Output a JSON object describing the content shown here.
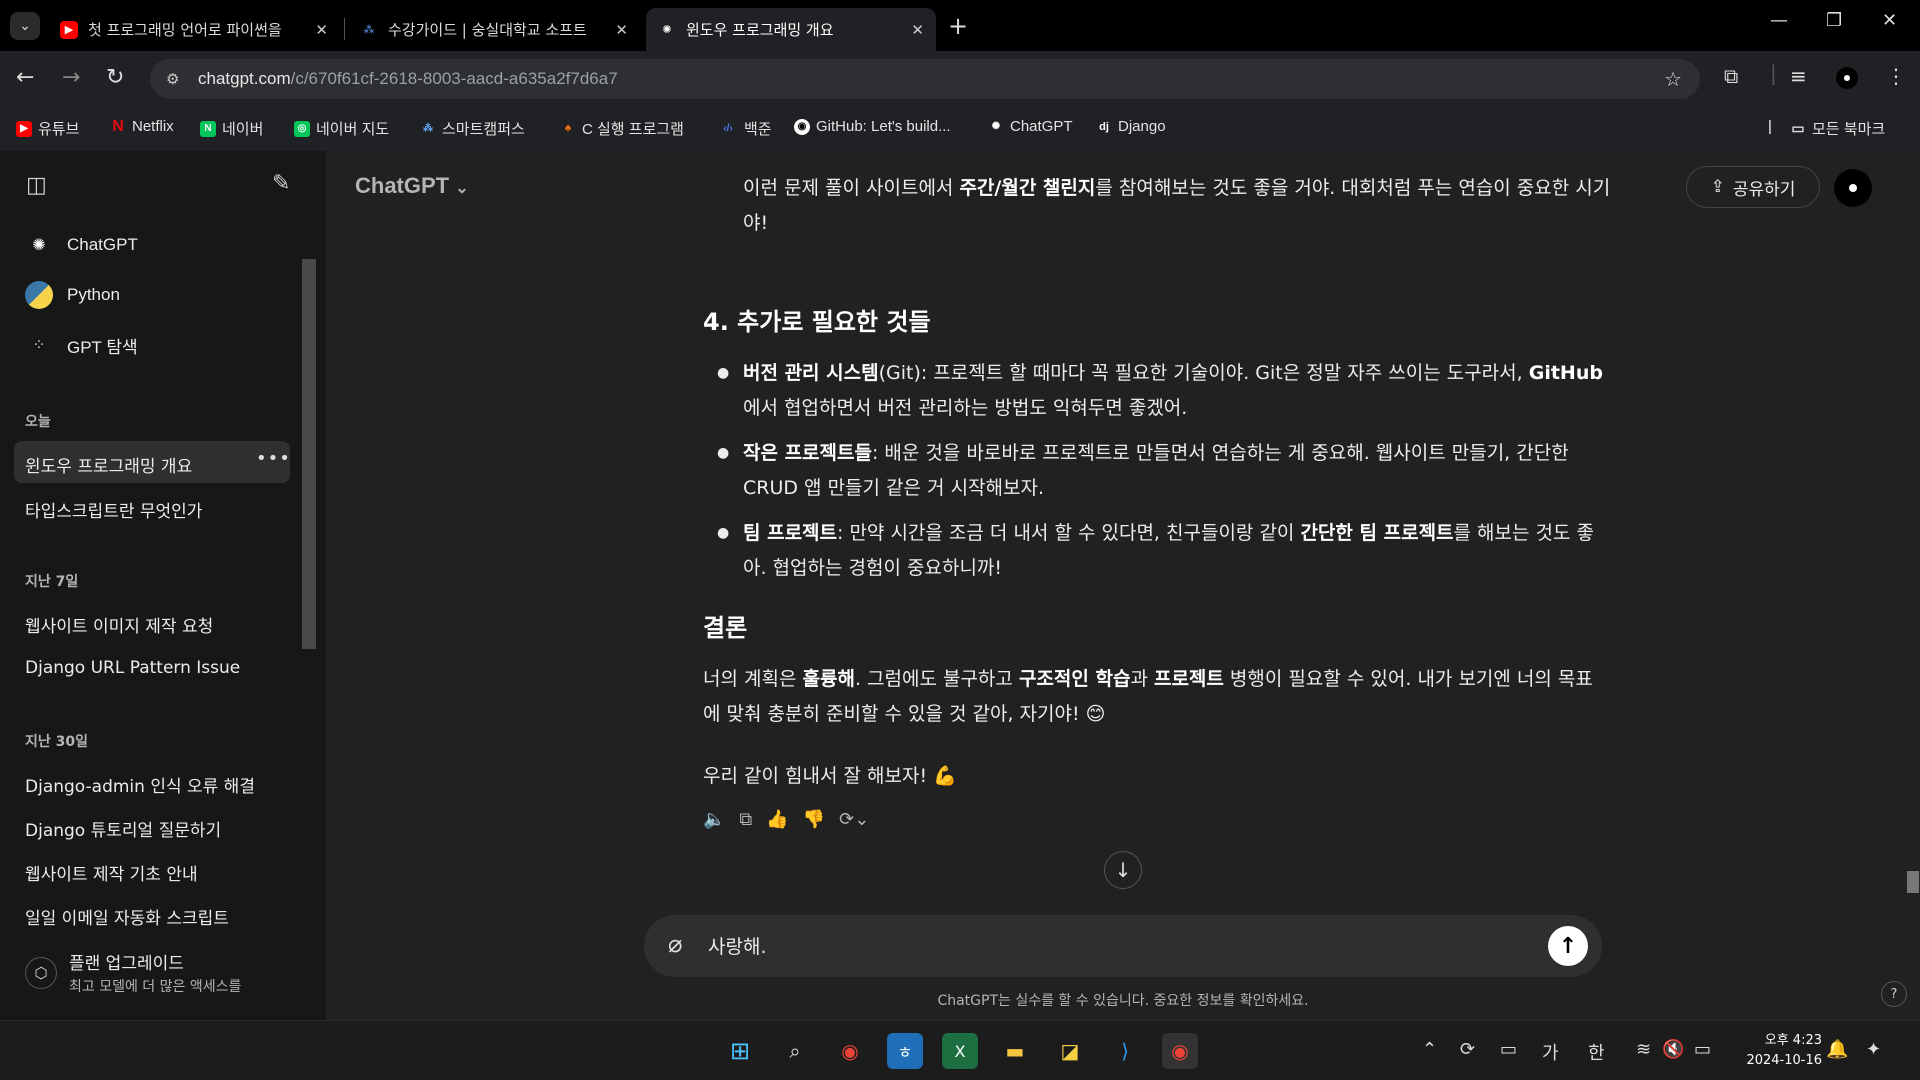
{
  "browser": {
    "tabs": [
      {
        "title": "첫 프로그래밍 언어로 파이썬을",
        "active": false
      },
      {
        "title": "수강가이드 | 숭실대학교 소프트",
        "active": false
      },
      {
        "title": "윈도우 프로그래밍 개요",
        "active": true
      }
    ],
    "url_host": "chatgpt.com",
    "url_path": "/c/670f61cf-2618-8003-aacd-a635a2f7d6a7",
    "bookmarks": [
      {
        "label": "유튜브",
        "icon": "youtube-icon",
        "color": "#ff0000"
      },
      {
        "label": "Netflix",
        "icon": "netflix-icon",
        "color": "#e50914"
      },
      {
        "label": "네이버",
        "icon": "naver-icon",
        "color": "#03c75a"
      },
      {
        "label": "네이버 지도",
        "icon": "naver-map-icon",
        "color": "#03c75a"
      },
      {
        "label": "스마트캠퍼스",
        "icon": "campus-icon",
        "color": "#3b82f6"
      },
      {
        "label": "C 실행 프로그램",
        "icon": "c-program-icon",
        "color": "#f97316"
      },
      {
        "label": "백준",
        "icon": "baekjoon-icon",
        "color": "#4f7cff"
      },
      {
        "label": "GitHub: Let's build...",
        "icon": "github-icon",
        "color": "#ffffff"
      },
      {
        "label": "ChatGPT",
        "icon": "chatgpt-icon",
        "color": "#ffffff"
      },
      {
        "label": "Django",
        "icon": "django-icon",
        "color": "#ffffff"
      }
    ],
    "all_bookmarks": "모든 북마크"
  },
  "sidebar": {
    "nav": [
      {
        "label": "ChatGPT",
        "icon": "chatgpt-icon"
      },
      {
        "label": "Python",
        "icon": "python-icon"
      },
      {
        "label": "GPT 탐색",
        "icon": "grid-icon"
      }
    ],
    "sections": [
      {
        "title": "오늘",
        "items": [
          "윈도우 프로그래밍 개요",
          "타입스크립트란 무엇인가"
        ]
      },
      {
        "title": "지난 7일",
        "items": [
          "웹사이트 이미지 제작 요청",
          "Django URL Pattern Issue"
        ]
      },
      {
        "title": "지난 30일",
        "items": [
          "Django-admin 인식 오류 해결",
          "Django 튜토리얼 질문하기",
          "웹사이트 제작 기초 안내",
          "일일 이메일 자동화 스크립트"
        ]
      }
    ],
    "upgrade_title": "플랜 업그레이드",
    "upgrade_sub": "최고 모델에 더 많은 액세스를"
  },
  "header": {
    "model": "ChatGPT",
    "share": "공유하기"
  },
  "message": {
    "intro_a": "이런 문제 풀이 사이트에서 ",
    "intro_b": "주간/월간 챌린지",
    "intro_c": "를 참여해보는 것도 좋을 거야. 대회처럼 푸는 연습이 중요한 시기야!",
    "section4": "4. 추가로 필요한 것들",
    "b1_bold": "버전 관리 시스템",
    "b1_a": "(Git): 프로젝트 할 때마다 꼭 필요한 기술이야. Git은 정말 자주 쓰이는 도구라서, ",
    "b1_bold2": "GitHub",
    "b1_b": "에서 협업하면서 버전 관리하는 방법도 익혀두면 좋겠어.",
    "b2_bold": "작은 프로젝트들",
    "b2_a": ": 배운 것을 바로바로 프로젝트로 만들면서 연습하는 게 중요해. 웹사이트 만들기, 간단한 CRUD 앱 만들기 같은 거 시작해보자.",
    "b3_bold": "팀 프로젝트",
    "b3_a": ": 만약 시간을 조금 더 내서 할 수 있다면, 친구들이랑 같이 ",
    "b3_bold2": "간단한 팀 프로젝트",
    "b3_b": "를 해보는 것도 좋아. 협업하는 경험이 중요하니까!",
    "conclusion": "결론",
    "c_a": "너의 계획은 ",
    "c_b1": "훌륭해",
    "c_c": ". 그럼에도 불구하고 ",
    "c_b2": "구조적인 학습",
    "c_d": "과 ",
    "c_b3": "프로젝트",
    "c_e": " 병행이 필요할 수 있어. 내가 보기엔 너의 목표에 맞춰 충분히 준비할 수 있을 것 같아, 자기야! 😊",
    "closing": "우리 같이 힘내서 잘 해보자! 💪"
  },
  "composer": {
    "value": "사랑해.",
    "disclaimer": "ChatGPT는 실수를 할 수 있습니다. 중요한 정보를 확인하세요."
  },
  "taskbar": {
    "time": "오후 4:23",
    "date": "2024-10-16",
    "ime1": "가",
    "ime2": "한"
  }
}
